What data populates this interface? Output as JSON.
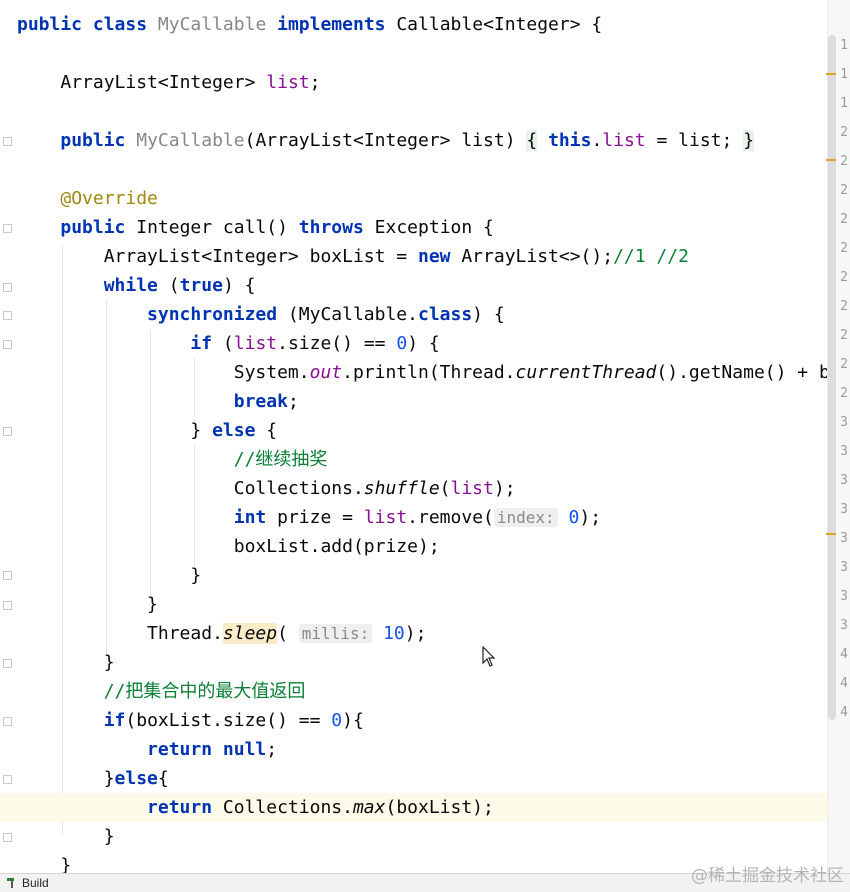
{
  "editor": {
    "class_decl": {
      "kw1": "public",
      "kw2": "class",
      "name": "MyCallable",
      "kw3": "implements",
      "iface": "Callable<Integer>",
      "brace": "{"
    },
    "field": {
      "type": "ArrayList<Integer>",
      "name": "list",
      "semi": ";"
    },
    "ctor": {
      "kw": "public",
      "name": "MyCallable",
      "params": "(ArrayList<Integer> list)",
      "open": "{",
      "this": "this",
      "dot": ".",
      "field": "list",
      "assign": " = list; ",
      "close": "}"
    },
    "annotation": "@Override",
    "method": {
      "kw": "public",
      "sig": "Integer call()",
      "throws": "throws",
      "exc": "Exception {"
    },
    "boxlist": {
      "decl": "ArrayList<Integer> boxList = ",
      "kw": "new",
      "ctor": "ArrayList<>();",
      "comment": "//1 //2"
    },
    "while_line": {
      "kw": "while",
      "open": " (",
      "val": "true",
      "close": ") {"
    },
    "sync_line": {
      "kw": "synchronized",
      "arg": " (MyCallable.",
      "cls": "class",
      "close": ") {"
    },
    "if_line": {
      "kw": "if",
      "open": " (",
      "field": "list",
      "rest": ".size() == ",
      "num": "0",
      "close": ") {"
    },
    "println_line": {
      "pre": "System.",
      "out": "out",
      "mid": ".println(Thread.",
      "cur": "currentThread",
      "rest": "().getName() + b"
    },
    "break_line": {
      "kw": "break",
      "semi": ";"
    },
    "else_line": {
      "close": "} ",
      "kw": "else",
      "open": " {"
    },
    "comment1": "//继续抽奖",
    "shuffle_line": {
      "pre": "Collections.",
      "m": "shuffle",
      "open": "(",
      "field": "list",
      "close": ");"
    },
    "prize_line": {
      "kw": "int",
      "mid": " prize = ",
      "field": "list",
      "call": ".remove(",
      "hint": "index:",
      "num": "0",
      "close": ");"
    },
    "add_line": "boxList.add(prize);",
    "close1": "}",
    "close2": "}",
    "sleep_line": {
      "pre": "Thread.",
      "m": "sleep",
      "open": "(",
      "hint": "millis:",
      "num": "10",
      "close": ");"
    },
    "close3": "}",
    "comment2": "//把集合中的最大值返回",
    "if2_line": {
      "kw": "if",
      "rest": "(boxList.size() == ",
      "num": "0",
      "close": "){"
    },
    "return_null": {
      "kw": "return",
      "sp": " ",
      "kw2": "null",
      "semi": ";"
    },
    "else2_line": {
      "close": "}",
      "kw": "else",
      "open": "{"
    },
    "return_max": {
      "kw": "return",
      "pre": " Collections.",
      "m": "max",
      "rest": "(boxList);"
    },
    "close4": "}",
    "close5": "}"
  },
  "line_numbers": [
    "1",
    "1",
    "1",
    "2",
    "2",
    "2",
    "2",
    "2",
    "2",
    "2",
    "2",
    "2",
    "2",
    "3",
    "3",
    "3",
    "3",
    "3",
    "3",
    "3",
    "3",
    "4",
    "4",
    "4"
  ],
  "statusbar": {
    "build_label": "Build"
  },
  "watermark": "@稀土掘金技术社区",
  "colors": {
    "keyword": "#0033b3",
    "field": "#871094",
    "number": "#1750eb",
    "annotation": "#9e880d",
    "comment": "#8c8c8c"
  }
}
